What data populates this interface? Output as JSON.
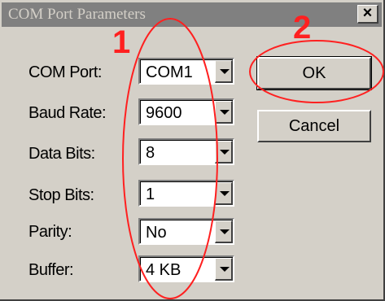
{
  "window": {
    "title": "COM Port Parameters",
    "close_symbol": "✕"
  },
  "fields": [
    {
      "label": "COM Port:",
      "value": "COM1"
    },
    {
      "label": "Baud Rate:",
      "value": "9600"
    },
    {
      "label": "Data Bits:",
      "value": "8"
    },
    {
      "label": "Stop Bits:",
      "value": "1"
    },
    {
      "label": "Parity:",
      "value": "No"
    },
    {
      "label": "Buffer:",
      "value": "4 KB"
    }
  ],
  "buttons": {
    "ok": "OK",
    "cancel": "Cancel"
  },
  "annotations": {
    "marker_1": "1",
    "marker_2": "2",
    "color": "#ff2020"
  },
  "colors": {
    "face": "#d4d0c8",
    "titlebar": "#808080"
  }
}
